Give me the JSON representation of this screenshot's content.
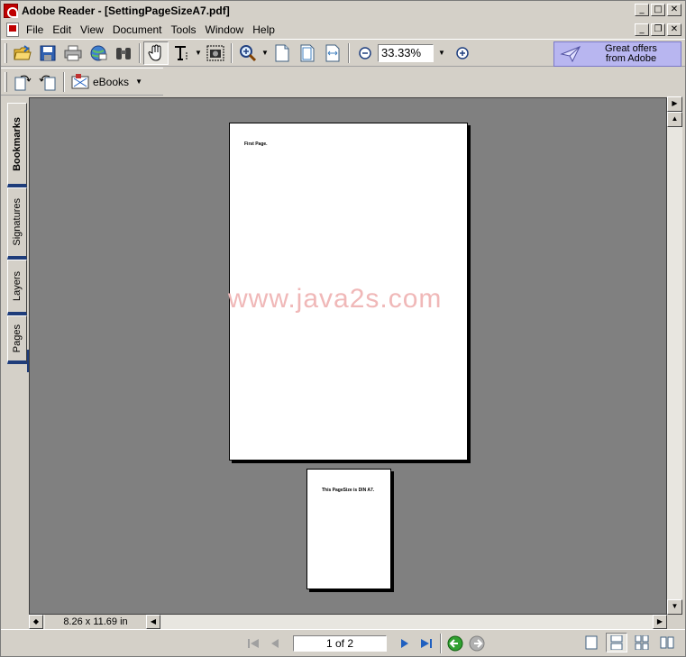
{
  "window": {
    "title": "Adobe Reader - [SettingPageSizeA7.pdf]",
    "controls": {
      "minimize": "_",
      "maximize": "□",
      "close": "✕",
      "restore": "❐"
    }
  },
  "menu": {
    "items": [
      "File",
      "Edit",
      "View",
      "Document",
      "Tools",
      "Window",
      "Help"
    ]
  },
  "toolbar": {
    "zoom_value": "33.33%",
    "offers_label_line1": "Great offers",
    "offers_label_line2": "from Adobe",
    "ebooks_label": "eBooks"
  },
  "nav_tabs": [
    "Bookmarks",
    "Signatures",
    "Layers",
    "Pages"
  ],
  "document": {
    "page1_text": "First Page.",
    "page2_text": "This PageSize is DIN A7.",
    "watermark": "www.java2s.com"
  },
  "status": {
    "page_size": "8.26 x 11.69 in",
    "page_indicator": "1 of 2"
  },
  "colors": {
    "chrome": "#d4d0c8",
    "viewport_bg": "#808080",
    "offers_bg": "#b8b6f0",
    "watermark": "#f0b8b8",
    "tab_accent": "#1e3c7a"
  }
}
